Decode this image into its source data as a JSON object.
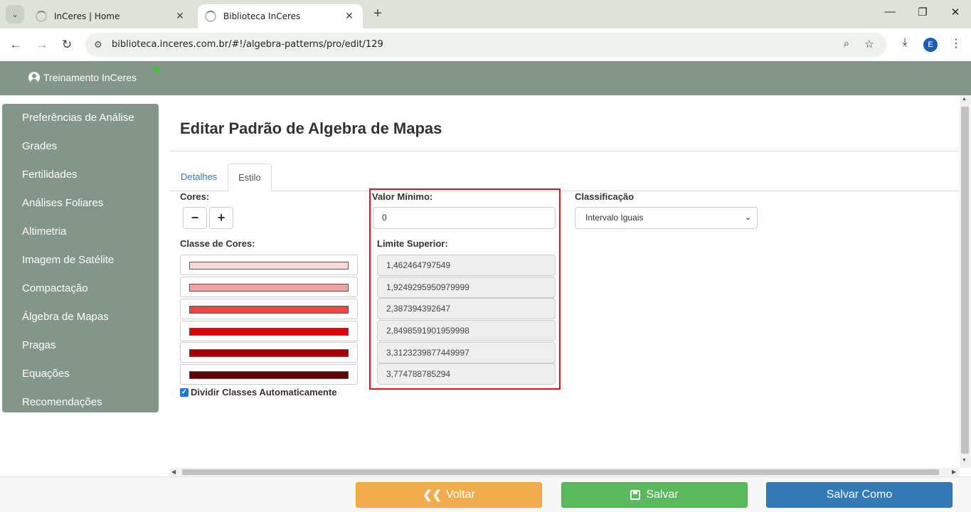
{
  "browser": {
    "tabs": [
      {
        "title": "InCeres | Home",
        "active": false
      },
      {
        "title": "Biblioteca InCeres",
        "active": true
      }
    ],
    "url": "biblioteca.inceres.com.br/#!/algebra-patterns/pro/edit/129",
    "profile_initial": "E"
  },
  "header": {
    "user_name": "Treinamento InCeres"
  },
  "sidebar": {
    "items": [
      {
        "label": "Preferências de Análise"
      },
      {
        "label": "Grades"
      },
      {
        "label": "Fertilidades"
      },
      {
        "label": "Análises Foliares"
      },
      {
        "label": "Altimetria"
      },
      {
        "label": "Imagem de Satélite"
      },
      {
        "label": "Compactação"
      },
      {
        "label": "Álgebra de Mapas"
      },
      {
        "label": "Pragas"
      },
      {
        "label": "Equações"
      },
      {
        "label": "Recomendações"
      }
    ]
  },
  "main": {
    "title": "Editar Padrão de Algebra de Mapas",
    "tabs": [
      {
        "label": "Detalhes",
        "active": false
      },
      {
        "label": "Estilo",
        "active": true
      }
    ],
    "cores_label": "Cores:",
    "minus_label": "−",
    "plus_label": "+",
    "classe_label": "Classe de Cores:",
    "color_classes": [
      "#fcd9d9",
      "#f4a3a3",
      "#f44343",
      "#e00000",
      "#a10000",
      "#650000"
    ],
    "auto_divide_label": "Dividir Classes Automaticamente",
    "auto_divide_checked": true,
    "valor_minimo_label": "Valor Mínimo:",
    "valor_minimo": "0",
    "limite_superior_label": "Limite Superior:",
    "limites": [
      "1,462464797549",
      "1,9249295950979999",
      "2,387394392647",
      "2,8498591901959998",
      "3,3123239877449997",
      "3,774788785294"
    ],
    "classificacao_label": "Classificação",
    "classificacao_value": "Intervalo Iguais"
  },
  "footer": {
    "voltar_label": "Voltar",
    "salvar_label": "Salvar",
    "salvar_como_label": "Salvar Como"
  },
  "colors": {
    "header_bg": "#849589",
    "highlight": "#e0131c",
    "voltar": "#f0ad4e",
    "salvar": "#5cb85c",
    "salvar_como": "#337ab7"
  }
}
